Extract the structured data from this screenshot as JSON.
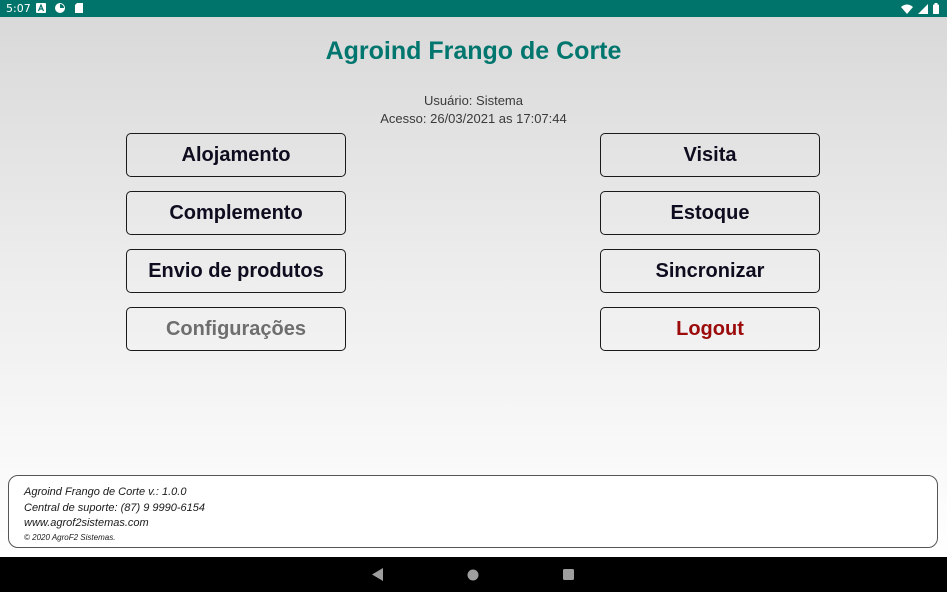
{
  "status_bar": {
    "time": "5:07",
    "left_icons": [
      "font-icon",
      "pie-icon",
      "sd-card-icon"
    ],
    "right_icons": [
      "wifi-icon",
      "signal-icon",
      "battery-icon"
    ]
  },
  "header": {
    "title": "Agroind Frango de Corte",
    "user_line": "Usuário: Sistema",
    "access_line": "Acesso: 26/03/2021 as 17:07:44"
  },
  "menu": {
    "alojamento": "Alojamento",
    "complemento": "Complemento",
    "envio": "Envio de produtos",
    "configuracoes": "Configurações",
    "visita": "Visita",
    "estoque": "Estoque",
    "sincronizar": "Sincronizar",
    "logout": "Logout"
  },
  "footer": {
    "version": "Agroind Frango de Corte v.: 1.0.0",
    "support": "Central de suporte: (87) 9 9990-6154",
    "website": "www.agrof2sistemas.com",
    "copyright": "© 2020 AgroF2 Sistemas."
  },
  "colors": {
    "status_bar": "#00736b",
    "title": "#00766e",
    "logout": "#9c0b0b",
    "disabled": "#6e6e6e"
  }
}
